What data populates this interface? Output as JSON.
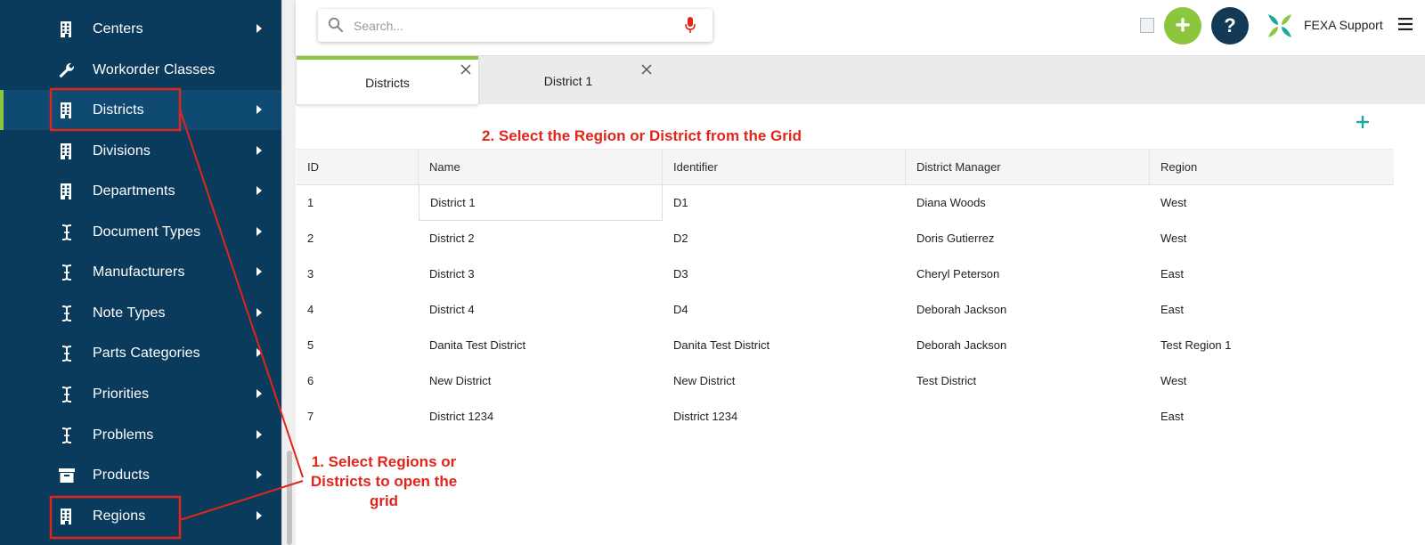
{
  "sidebar": {
    "items": [
      {
        "label": "Centers",
        "icon": "building-icon",
        "has_arrow": true,
        "active": false
      },
      {
        "label": "Workorder Classes",
        "icon": "wrench-icon",
        "has_arrow": false,
        "active": false
      },
      {
        "label": "Districts",
        "icon": "building-icon",
        "has_arrow": true,
        "active": true
      },
      {
        "label": "Divisions",
        "icon": "building-icon",
        "has_arrow": true,
        "active": false
      },
      {
        "label": "Departments",
        "icon": "building-icon",
        "has_arrow": true,
        "active": false
      },
      {
        "label": "Document Types",
        "icon": "i-beam-icon",
        "has_arrow": true,
        "active": false
      },
      {
        "label": "Manufacturers",
        "icon": "i-beam-icon",
        "has_arrow": true,
        "active": false
      },
      {
        "label": "Note Types",
        "icon": "i-beam-icon",
        "has_arrow": true,
        "active": false
      },
      {
        "label": "Parts Categories",
        "icon": "i-beam-icon",
        "has_arrow": true,
        "active": false
      },
      {
        "label": "Priorities",
        "icon": "i-beam-icon",
        "has_arrow": true,
        "active": false
      },
      {
        "label": "Problems",
        "icon": "i-beam-icon",
        "has_arrow": true,
        "active": false
      },
      {
        "label": "Products",
        "icon": "archive-icon",
        "has_arrow": true,
        "active": false
      },
      {
        "label": "Regions",
        "icon": "building-icon",
        "has_arrow": true,
        "active": false
      }
    ]
  },
  "header": {
    "search_placeholder": "Search...",
    "user_name": "FEXA Support"
  },
  "tabs": [
    {
      "label": "Districts",
      "active": true
    },
    {
      "label": "District 1",
      "active": false
    }
  ],
  "annotations": {
    "step1": "1. Select Regions or Districts to open the grid",
    "step2": "2. Select the Region or District from the Grid"
  },
  "grid": {
    "columns": [
      "ID",
      "Name",
      "Identifier",
      "District Manager",
      "Region"
    ],
    "rows": [
      [
        "1",
        "District 1",
        "D1",
        "Diana Woods",
        "West"
      ],
      [
        "2",
        "District 2",
        "D2",
        "Doris Gutierrez",
        "West"
      ],
      [
        "3",
        "District 3",
        "D3",
        "Cheryl Peterson",
        "East"
      ],
      [
        "4",
        "District 4",
        "D4",
        "Deborah Jackson",
        "East"
      ],
      [
        "5",
        "Danita Test District",
        "Danita Test District",
        "Deborah Jackson",
        "Test Region 1"
      ],
      [
        "6",
        "New District",
        "New District",
        "Test District",
        "West"
      ],
      [
        "7",
        "District 1234",
        "District 1234",
        "",
        "East"
      ]
    ]
  },
  "colors": {
    "sidebar_bg": "#0b3b5c",
    "accent_green": "#8cc63f",
    "annotation_red": "#e0251b",
    "grid_add_teal": "#1aa99b"
  }
}
